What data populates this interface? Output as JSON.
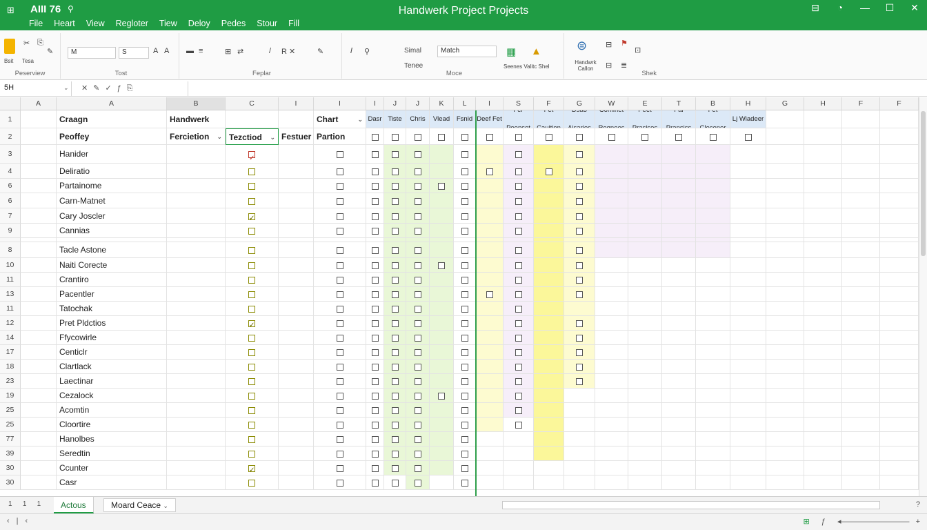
{
  "titlebar": {
    "app_name": "AIII 76",
    "title": "Handwerk Project Projects"
  },
  "menu": [
    "File",
    "Heart",
    "View",
    "Regloter",
    "Tiew",
    "Deloy",
    "Pedes",
    "Stour",
    "Fill"
  ],
  "ribbon": {
    "groups": [
      "Peserview",
      "Tost",
      "Feplar",
      "Moce",
      "Shek"
    ],
    "paste_label": "Bsit",
    "paste_label2": "Tesa",
    "font_combo": "M",
    "font_size_combo": "S",
    "style_labels": [
      "Simal",
      "Tenee"
    ],
    "match_combo": "Match",
    "conditional_label": "Seenes Valitc Shel",
    "handwerk_label": "Handwrk Callon"
  },
  "formula": {
    "name_box": "5H"
  },
  "column_headers": [
    "A",
    "A",
    "B",
    "C",
    "I",
    "I",
    "I",
    "J",
    "J",
    "K",
    "L",
    "I",
    "S",
    "F",
    "G",
    "W",
    "E",
    "T",
    "B",
    "H",
    "G",
    "H",
    "F",
    "F"
  ],
  "header_row1": {
    "col_a": "Craagn",
    "col_b": "Handwerk",
    "chart": "Chart",
    "small": [
      "Dasr",
      "Tiste",
      "Chris",
      "Earlist Vlead Net",
      "Lasd Fsnid Itesa",
      "Deef Fet",
      "Fer Peepset",
      "Fet Cauition",
      "Dsao Aisaries",
      "Confinet Regnees",
      "Peet Prasises",
      "Fal Prapsiss",
      "Fet Clecener",
      "Lj Wiadeer"
    ]
  },
  "header_row2": {
    "col_a": "Peoffey",
    "col_b": "Fercietion",
    "col_c": "Tezctiod",
    "col_d": "Festuer",
    "col_e": "Partion"
  },
  "row_numbers": [
    "1",
    "2",
    "3",
    "4",
    "6",
    "6",
    "7",
    "9",
    "",
    "8",
    "10",
    "11",
    "13",
    "11",
    "12",
    "14",
    "17",
    "18",
    "23",
    "19",
    "25",
    "25",
    "77",
    "39",
    "30",
    "30"
  ],
  "names": [
    "Hanider",
    "Deliratio",
    "Partainome",
    "Carn-Matnet",
    "Cary Joscler",
    "Cannias",
    "",
    "Tacle Astone",
    "Naiti Corecte",
    "Crantiro",
    "Pacentler",
    "Tatochak",
    "Pret Pldctios",
    "Ffycowirle",
    "Centiclr",
    "Clartlack",
    "Laectinar",
    "Cezalock",
    "Acomtin",
    "Cloortire",
    "Hanolbes",
    "Seredtin",
    "Ccunter",
    "Casr"
  ],
  "sheet_tabs": [
    "Actous",
    "Moard Ceace"
  ],
  "sheet_nav": [
    "1",
    "1",
    "1"
  ],
  "colors": {
    "green_accent": "#1f9c44",
    "light_green": "#e9f7d7",
    "light_yellow": "#fdfbd0",
    "light_lavender": "#f6eef9",
    "yellow_col": "#fbf79a",
    "blue_header": "#dce9f7"
  }
}
